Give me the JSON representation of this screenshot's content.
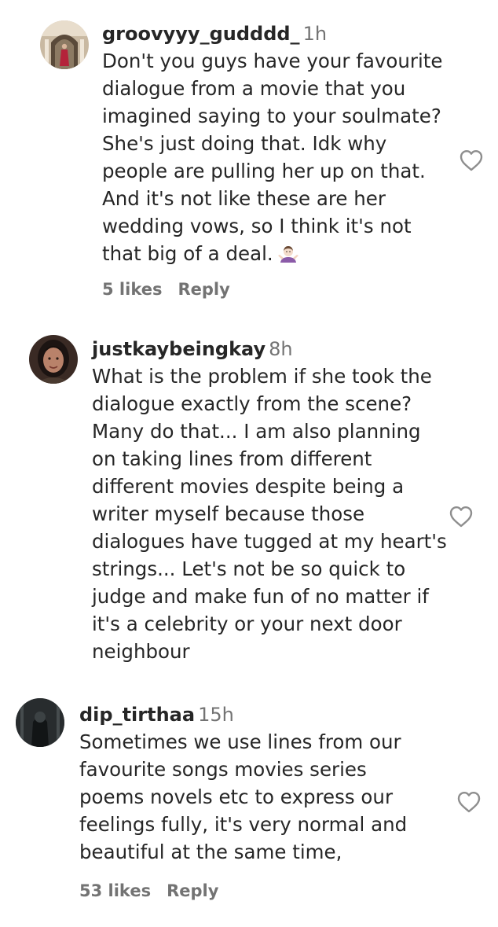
{
  "comments": [
    {
      "username": "groovyyy_gudddd_",
      "time": "1h",
      "text": "Don't you guys have your favourite\ndialogue from a movie that you\nimagined saying to your soulmate?\nShe's just doing that. Idk why\npeople are pulling her up on that.\nAnd it's not like these are her\nwedding vows, so I think it's not\nthat big of a deal.",
      "emoji": "person-shrugging-emoji",
      "likes": "5 likes",
      "reply": "Reply"
    },
    {
      "username": "justkaybeingkay",
      "time": "8h",
      "text": "What is the problem if she took the\ndialogue exactly from the scene?\nMany do that... I am also planning\non taking lines from different\ndifferent movies despite being a\nwriter myself because those\ndialogues have tugged at my heart's\nstrings... Let's not be so quick to\njudge and make fun of no matter if\nit's a celebrity or your next door\nneighbour"
    },
    {
      "username": "dip_tirthaa",
      "time": "15h",
      "text": "Sometimes we use lines from our\nfavourite songs movies series\npoems novels etc to express our\nfeelings fully, it's very normal and\nbeautiful at the same time,",
      "likes": "53 likes",
      "reply": "Reply"
    }
  ],
  "icons": {
    "like": "heart-outline-icon"
  },
  "colors": {
    "text": "#262626",
    "secondary": "#737373"
  }
}
